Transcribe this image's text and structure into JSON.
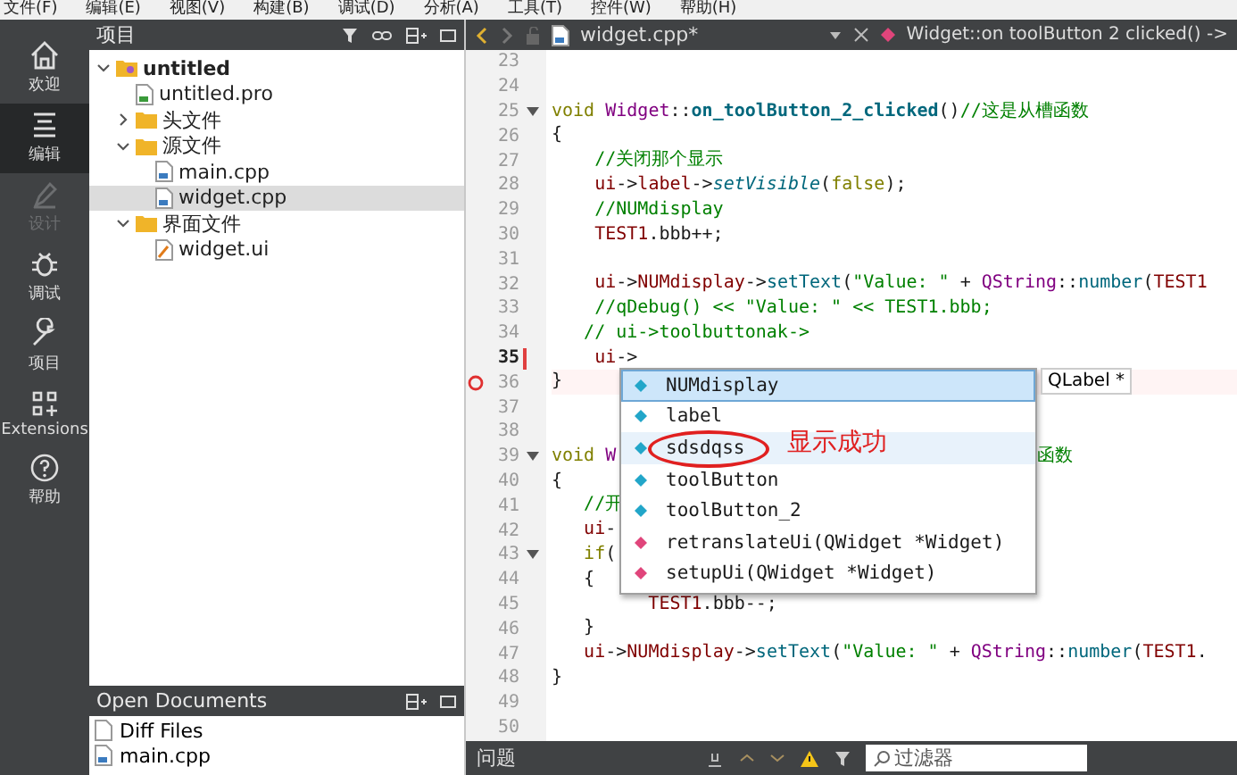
{
  "menu": [
    "文件(F)",
    "编辑(E)",
    "视图(V)",
    "构建(B)",
    "调试(D)",
    "分析(A)",
    "工具(T)",
    "控件(W)",
    "帮助(H)"
  ],
  "modes": [
    {
      "label": "欢迎",
      "kind": "home",
      "selected": false,
      "disabled": false
    },
    {
      "label": "编辑",
      "kind": "edit",
      "selected": true,
      "disabled": false
    },
    {
      "label": "设计",
      "kind": "design",
      "selected": false,
      "disabled": true
    },
    {
      "label": "调试",
      "kind": "debug",
      "selected": false,
      "disabled": false
    },
    {
      "label": "项目",
      "kind": "wrench",
      "selected": false,
      "disabled": false
    },
    {
      "label": "Extensions",
      "kind": "ext",
      "selected": false,
      "disabled": false
    },
    {
      "label": "帮助",
      "kind": "help",
      "selected": false,
      "disabled": false
    }
  ],
  "project_panel": {
    "title": "项目",
    "tree": [
      {
        "label": "untitled",
        "kind": "project",
        "expanded": true,
        "selected": false,
        "children": [
          {
            "label": "untitled.pro",
            "kind": "pro",
            "selected": false
          },
          {
            "label": "头文件",
            "kind": "folder",
            "expanded": false,
            "selected": false
          },
          {
            "label": "源文件",
            "kind": "folder",
            "expanded": true,
            "selected": false,
            "children": [
              {
                "label": "main.cpp",
                "kind": "cpp",
                "selected": false
              },
              {
                "label": "widget.cpp",
                "kind": "cpp",
                "selected": true
              }
            ]
          },
          {
            "label": "界面文件",
            "kind": "folder",
            "expanded": true,
            "selected": false,
            "children": [
              {
                "label": "widget.ui",
                "kind": "ui",
                "selected": false
              }
            ]
          }
        ]
      }
    ]
  },
  "open_documents": {
    "title": "Open Documents",
    "items": [
      {
        "label": "Diff Files",
        "kind": "doc"
      },
      {
        "label": "main.cpp",
        "kind": "cpp"
      }
    ]
  },
  "editor_tab": {
    "file": "widget.cpp*",
    "symbol": "Widget::on toolButton 2 clicked() ->"
  },
  "lines": [
    {
      "n": "23"
    },
    {
      "n": "24"
    },
    {
      "n": "25",
      "fold": true,
      "segs": [
        {
          "kind": "kw",
          "text": "void "
        },
        {
          "kind": "type",
          "text": "Widget"
        },
        {
          "kind": "plain",
          "text": "::"
        },
        {
          "kind": "fnb",
          "text": "on_toolButton_2_clicked"
        },
        {
          "kind": "plain",
          "text": "()"
        },
        {
          "kind": "cmt",
          "text": "//这是从槽函数"
        }
      ]
    },
    {
      "n": "26",
      "segs": [
        {
          "kind": "plain",
          "text": "{"
        }
      ]
    },
    {
      "n": "27",
      "segs": [
        {
          "kind": "cmt",
          "text": "    //关闭那个显示"
        }
      ]
    },
    {
      "n": "28",
      "segs": [
        {
          "kind": "var",
          "text": "    ui"
        },
        {
          "kind": "plain",
          "text": "->"
        },
        {
          "kind": "var",
          "text": "label"
        },
        {
          "kind": "plain",
          "text": "->"
        },
        {
          "kind": "fni",
          "text": "setVisible"
        },
        {
          "kind": "plain",
          "text": "("
        },
        {
          "kind": "kw",
          "text": "false"
        },
        {
          "kind": "plain",
          "text": ");"
        }
      ]
    },
    {
      "n": "29",
      "segs": [
        {
          "kind": "cmt",
          "text": "    //NUMdisplay"
        }
      ]
    },
    {
      "n": "30",
      "segs": [
        {
          "kind": "var",
          "text": "    TEST1"
        },
        {
          "kind": "plain",
          "text": ".bbb++;"
        }
      ]
    },
    {
      "n": "31"
    },
    {
      "n": "32",
      "segs": [
        {
          "kind": "var",
          "text": "    ui"
        },
        {
          "kind": "plain",
          "text": "->"
        },
        {
          "kind": "var",
          "text": "NUMdisplay"
        },
        {
          "kind": "plain",
          "text": "->"
        },
        {
          "kind": "fn",
          "text": "setText"
        },
        {
          "kind": "plain",
          "text": "("
        },
        {
          "kind": "str",
          "text": "\"Value: \""
        },
        {
          "kind": "plain",
          "text": " + "
        },
        {
          "kind": "type",
          "text": "QString"
        },
        {
          "kind": "plain",
          "text": "::"
        },
        {
          "kind": "fn",
          "text": "number"
        },
        {
          "kind": "plain",
          "text": "("
        },
        {
          "kind": "var",
          "text": "TEST1"
        }
      ]
    },
    {
      "n": "33",
      "segs": [
        {
          "kind": "cmt",
          "text": "    //qDebug() << \"Value: \" << TEST1.bbb;"
        }
      ]
    },
    {
      "n": "34",
      "segs": [
        {
          "kind": "cmt",
          "text": "   // ui->toolbuttonak->"
        }
      ]
    },
    {
      "n": "35",
      "modified": true,
      "segs": [
        {
          "kind": "var",
          "text": "    ui"
        },
        {
          "kind": "plain",
          "text": "->"
        }
      ]
    },
    {
      "n": "36",
      "breakpoint": true,
      "segs": [
        {
          "kind": "plain",
          "text": "}"
        }
      ]
    },
    {
      "n": "37"
    },
    {
      "n": "38"
    },
    {
      "n": "39",
      "fold": true,
      "segs": [
        {
          "kind": "kw",
          "text": "void "
        },
        {
          "kind": "type",
          "text": "W"
        }
      ],
      "tail": [
        {
          "kind": "cmt",
          "text": "函数"
        }
      ]
    },
    {
      "n": "40",
      "segs": [
        {
          "kind": "plain",
          "text": "{"
        }
      ]
    },
    {
      "n": "41",
      "segs": [
        {
          "kind": "cmt",
          "text": "   //开"
        }
      ]
    },
    {
      "n": "42",
      "segs": [
        {
          "kind": "var",
          "text": "   ui"
        },
        {
          "kind": "plain",
          "text": "-"
        }
      ]
    },
    {
      "n": "43",
      "fold": true,
      "segs": [
        {
          "kind": "kw",
          "text": "   if"
        },
        {
          "kind": "plain",
          "text": "("
        }
      ]
    },
    {
      "n": "44",
      "segs": [
        {
          "kind": "plain",
          "text": "   {"
        }
      ]
    },
    {
      "n": "45",
      "segs": [
        {
          "kind": "var",
          "text": "         TEST1"
        },
        {
          "kind": "plain",
          "text": ".bbb--;"
        }
      ]
    },
    {
      "n": "46",
      "segs": [
        {
          "kind": "plain",
          "text": "   }"
        }
      ]
    },
    {
      "n": "47",
      "segs": [
        {
          "kind": "var",
          "text": "   ui"
        },
        {
          "kind": "plain",
          "text": "->"
        },
        {
          "kind": "var",
          "text": "NUMdisplay"
        },
        {
          "kind": "plain",
          "text": "->"
        },
        {
          "kind": "fn",
          "text": "setText"
        },
        {
          "kind": "plain",
          "text": "("
        },
        {
          "kind": "str",
          "text": "\"Value: \""
        },
        {
          "kind": "plain",
          "text": " + "
        },
        {
          "kind": "type",
          "text": "QString"
        },
        {
          "kind": "plain",
          "text": "::"
        },
        {
          "kind": "fn",
          "text": "number"
        },
        {
          "kind": "plain",
          "text": "("
        },
        {
          "kind": "var",
          "text": "TEST1"
        },
        {
          "kind": "plain",
          "text": "."
        }
      ]
    },
    {
      "n": "48",
      "segs": [
        {
          "kind": "plain",
          "text": "}"
        }
      ]
    },
    {
      "n": "49"
    },
    {
      "n": "50"
    }
  ],
  "completion": {
    "items": [
      {
        "label": "NUMdisplay",
        "kind": "member",
        "selected": true,
        "circled": false
      },
      {
        "label": "label",
        "kind": "member",
        "selected": false,
        "circled": false
      },
      {
        "label": "sdsdqss",
        "kind": "member",
        "selected": false,
        "circled": true
      },
      {
        "label": "toolButton",
        "kind": "member",
        "selected": false,
        "circled": false
      },
      {
        "label": "toolButton_2",
        "kind": "member",
        "selected": false,
        "circled": false
      },
      {
        "label": "retranslateUi(QWidget *Widget)",
        "kind": "method",
        "selected": false,
        "circled": false
      },
      {
        "label": "setupUi(QWidget *Widget)",
        "kind": "method",
        "selected": false,
        "circled": false
      }
    ],
    "detail": "QLabel *",
    "annotation": "显示成功"
  },
  "output_bar": {
    "title": "问题",
    "filter_placeholder": "过滤器"
  }
}
